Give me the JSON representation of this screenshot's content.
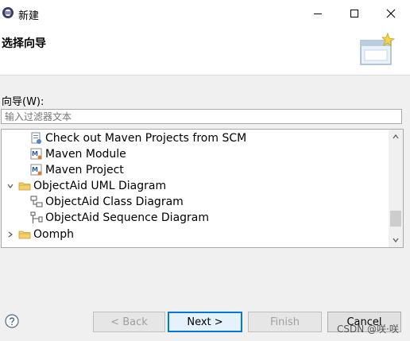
{
  "window": {
    "title": "新建"
  },
  "header": {
    "title": "选择向导"
  },
  "wizards": {
    "label": "向导(W):",
    "filter_placeholder": "输入过滤器文本",
    "tree": [
      {
        "label": "Check out Maven Projects from SCM",
        "icon": "maven-checkout-icon"
      },
      {
        "label": "Maven Module",
        "icon": "maven-icon"
      },
      {
        "label": "Maven Project",
        "icon": "maven-icon"
      },
      {
        "label": "ObjectAid UML Diagram",
        "icon": "folder-icon",
        "expanded": true
      },
      {
        "label": "ObjectAid Class Diagram",
        "icon": "class-diagram-icon"
      },
      {
        "label": "ObjectAid Sequence Diagram",
        "icon": "sequence-diagram-icon"
      },
      {
        "label": "Oomph",
        "icon": "folder-icon",
        "expanded": false
      }
    ]
  },
  "buttons": {
    "back": "< Back",
    "next": "Next >",
    "finish": "Finish",
    "cancel": "Cancel"
  },
  "watermark": "CSDN @咲·咲",
  "colors": {
    "accent": "#0078d7",
    "folder": "#e8b64a"
  }
}
